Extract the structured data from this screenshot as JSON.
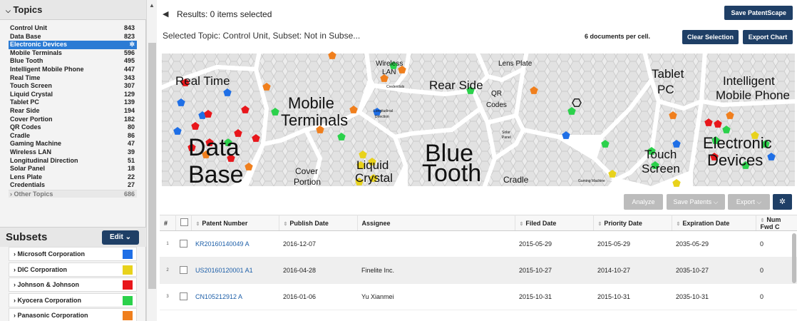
{
  "topics": {
    "header": "Topics",
    "items": [
      {
        "label": "Control Unit",
        "count": "843"
      },
      {
        "label": "Data Base",
        "count": "823"
      },
      {
        "label": "Electronic Devices",
        "count": "",
        "selected": true
      },
      {
        "label": "Mobile Terminals",
        "count": "596"
      },
      {
        "label": "Blue Tooth",
        "count": "495"
      },
      {
        "label": "Intelligent Mobile Phone",
        "count": "447"
      },
      {
        "label": "Real Time",
        "count": "343"
      },
      {
        "label": "Touch Screen",
        "count": "307"
      },
      {
        "label": "Liquid Crystal",
        "count": "129"
      },
      {
        "label": "Tablet PC",
        "count": "139"
      },
      {
        "label": "Rear Side",
        "count": "194"
      },
      {
        "label": "Cover Portion",
        "count": "182"
      },
      {
        "label": "QR Codes",
        "count": "80"
      },
      {
        "label": "Cradle",
        "count": "86"
      },
      {
        "label": "Gaming Machine",
        "count": "47"
      },
      {
        "label": "Wireless LAN",
        "count": "39"
      },
      {
        "label": "Longitudinal Direction",
        "count": "51"
      },
      {
        "label": "Solar Panel",
        "count": "18"
      },
      {
        "label": "Lens Plate",
        "count": "22"
      },
      {
        "label": "Credentials",
        "count": "27"
      }
    ],
    "other": {
      "label": "Other Topics",
      "count": "686"
    }
  },
  "subsets": {
    "header": "Subsets",
    "edit_label": "Edit",
    "items": [
      {
        "label": "Microsoft Corporation",
        "color": "#1f6fe6"
      },
      {
        "label": "DIC Corporation",
        "color": "#e8d21c"
      },
      {
        "label": "Johnson & Johnson",
        "color": "#e8161b"
      },
      {
        "label": "Kyocera Corporation",
        "color": "#2bd14b"
      },
      {
        "label": "Panasonic Corporation",
        "color": "#f07f1d"
      }
    ]
  },
  "header": {
    "results": "Results: 0 items selected",
    "save_patentscape": "Save PatentScape",
    "selected_topic": "Selected Topic: Control Unit, Subset: Not in Subse...",
    "docs_per_cell": "6 documents per cell.",
    "clear_selection": "Clear Selection",
    "export_chart": "Export Chart"
  },
  "map": {
    "labels": [
      {
        "text": "Real Time",
        "size": "big"
      },
      {
        "text": "Data",
        "size": "huge"
      },
      {
        "text": "Base",
        "size": "huge"
      },
      {
        "text": "Mobile",
        "size": "large"
      },
      {
        "text": "Terminals",
        "size": "large"
      },
      {
        "text": "Wireless",
        "size": "small"
      },
      {
        "text": "LAN",
        "size": "small"
      },
      {
        "text": "Credentials",
        "size": "tiny"
      },
      {
        "text": "Rear Side",
        "size": "big"
      },
      {
        "text": "Lens Plate",
        "size": "small"
      },
      {
        "text": "QR",
        "size": "small"
      },
      {
        "text": "Codes",
        "size": "small"
      },
      {
        "text": "Longitudinal",
        "size": "tiny"
      },
      {
        "text": "Direction",
        "size": "tiny"
      },
      {
        "text": "Blue",
        "size": "huge"
      },
      {
        "text": "Tooth",
        "size": "huge"
      },
      {
        "text": "Solar",
        "size": "tiny"
      },
      {
        "text": "Panel",
        "size": "tiny"
      },
      {
        "text": "Cover",
        "size": "med"
      },
      {
        "text": "Portion",
        "size": "med"
      },
      {
        "text": "Liquid",
        "size": "big"
      },
      {
        "text": "Crystal",
        "size": "big"
      },
      {
        "text": "Cradle",
        "size": "med"
      },
      {
        "text": "Tablet",
        "size": "big"
      },
      {
        "text": "PC",
        "size": "big"
      },
      {
        "text": "Intelligent",
        "size": "big"
      },
      {
        "text": "Mobile Phone",
        "size": "big"
      },
      {
        "text": "Touch",
        "size": "big"
      },
      {
        "text": "Screen",
        "size": "big"
      },
      {
        "text": "Electronic",
        "size": "large"
      },
      {
        "text": "Devices",
        "size": "large"
      },
      {
        "text": "Gaming Machine",
        "size": "tiny"
      }
    ]
  },
  "toolbar": {
    "analyze": "Analyze",
    "save_patents": "Save Patents",
    "export": "Export"
  },
  "table": {
    "columns": [
      "#",
      "",
      "Patent Number",
      "Publish Date",
      "Assignee",
      "Filed Date",
      "Priority Date",
      "Expiration Date",
      "Num Fwd C"
    ],
    "rows": [
      {
        "num": "1",
        "patent": "KR20160140049 A",
        "publish": "2016-12-07",
        "assignee": "",
        "filed": "2015-05-29",
        "priority": "2015-05-29",
        "expiration": "2035-05-29",
        "fwd": "0"
      },
      {
        "num": "2",
        "patent": "US20160120001 A1",
        "publish": "2016-04-28",
        "assignee": "Finelite Inc.",
        "filed": "2015-10-27",
        "priority": "2014-10-27",
        "expiration": "2035-10-27",
        "fwd": "0"
      },
      {
        "num": "3",
        "patent": "CN105212912 A",
        "publish": "2016-01-06",
        "assignee": "Yu Xianmei",
        "filed": "2015-10-31",
        "priority": "2015-10-31",
        "expiration": "2035-10-31",
        "fwd": "0"
      }
    ]
  }
}
